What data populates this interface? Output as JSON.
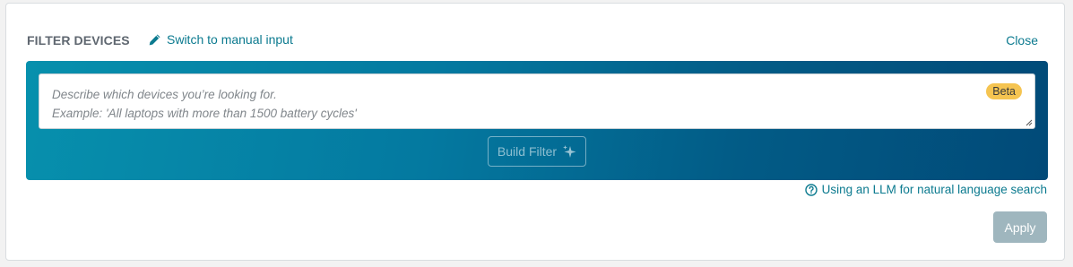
{
  "panel": {
    "title": "FILTER DEVICES",
    "switch_link": "Switch to manual input",
    "close_label": "Close"
  },
  "ai_search": {
    "placeholder_line1": "Describe which devices you’re looking for.",
    "placeholder_line2": "Example: 'All laptops with more than 1500 battery cycles'",
    "badge": "Beta",
    "build_button": "Build Filter"
  },
  "help_link": "Using an LLM for natural language search",
  "apply_button": "Apply",
  "icons": {
    "switch": "pencil-icon",
    "build": "sparkle-icon",
    "help": "question-circle-icon"
  },
  "colors": {
    "accent": "#0b7a8f",
    "gradient_start": "#0790ad",
    "gradient_end": "#014a78",
    "badge": "#f5c451",
    "apply_disabled": "#9fb6be"
  }
}
